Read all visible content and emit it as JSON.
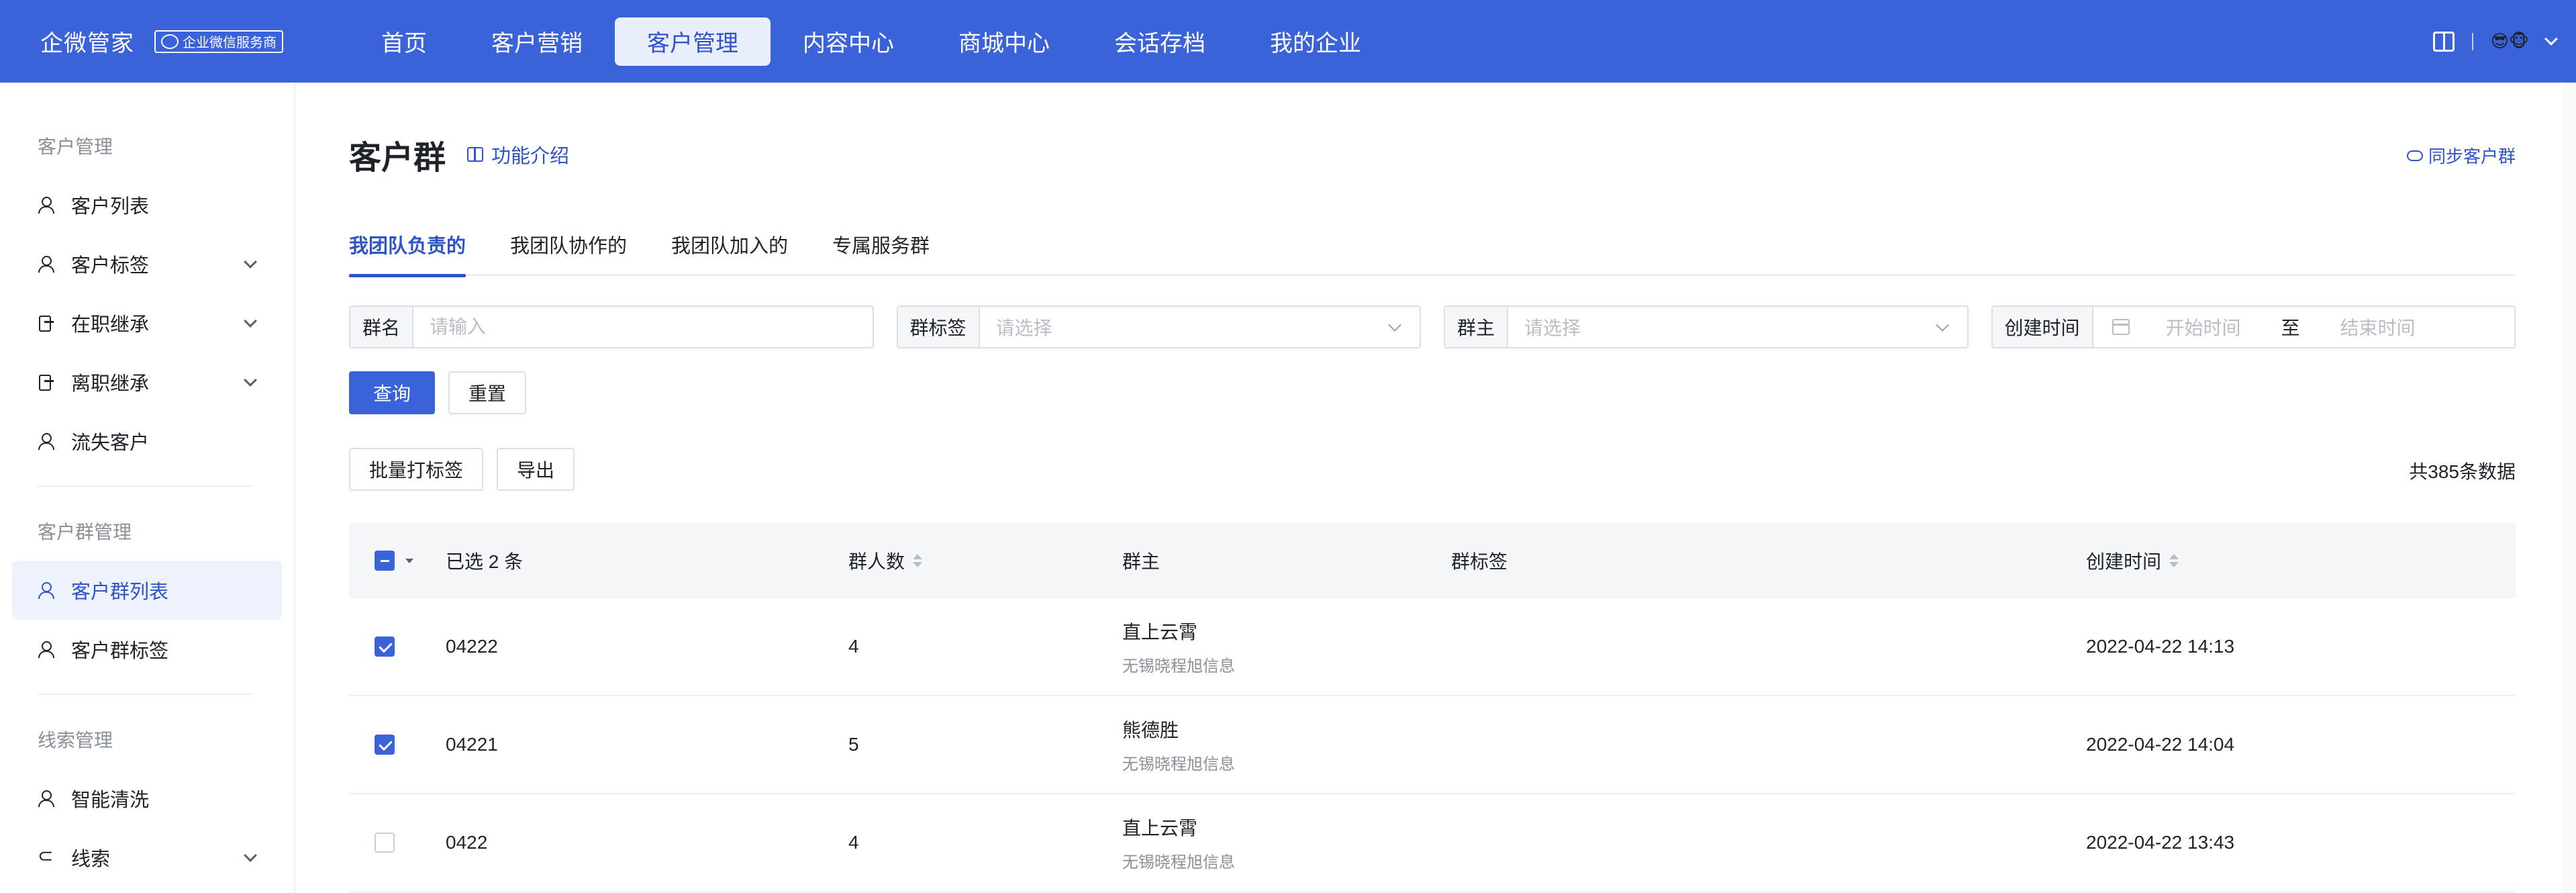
{
  "topbar": {
    "brand": "企微管家",
    "badge": "企业微信服务商",
    "nav": [
      "首页",
      "客户营销",
      "客户管理",
      "内容中心",
      "商城中心",
      "会话存档",
      "我的企业"
    ],
    "active_nav": 2,
    "avatar_emoji": "😎🐵",
    "accent": "#3a62d9"
  },
  "sidebar": {
    "group1": "客户管理",
    "items1": [
      {
        "label": "客户列表",
        "icon": "user-icon"
      },
      {
        "label": "客户标签",
        "icon": "user-icon"
      },
      {
        "label": "在职继承",
        "icon": "door-icon"
      },
      {
        "label": "离职继承",
        "icon": "door-icon"
      },
      {
        "label": "流失客户",
        "icon": "user-icon"
      }
    ],
    "group2": "客户群管理",
    "items2": [
      {
        "label": "客户群列表",
        "icon": "user-icon"
      },
      {
        "label": "客户群标签",
        "icon": "user-icon"
      }
    ],
    "group3": "线索管理",
    "items3": [
      {
        "label": "智能清洗",
        "icon": "user-icon"
      },
      {
        "label": "线索",
        "icon": "link-icon"
      }
    ]
  },
  "page": {
    "title": "客户群",
    "func_intro": "功能介绍",
    "sync": "同步客户群",
    "tabs": [
      "我团队负责的",
      "我团队协作的",
      "我团队加入的",
      "专属服务群"
    ],
    "active_tab": 0
  },
  "filters": {
    "group_name_label": "群名",
    "group_name_placeholder": "请输入",
    "group_tag_label": "群标签",
    "group_tag_placeholder": "请选择",
    "owner_label": "群主",
    "owner_placeholder": "请选择",
    "created_label": "创建时间",
    "start_placeholder": "开始时间",
    "range_sep": "至",
    "end_placeholder": "结束时间"
  },
  "actions": {
    "query": "查询",
    "reset": "重置",
    "batch_tag": "批量打标签",
    "export": "导出",
    "total": "共385条数据"
  },
  "table": {
    "selected": "已选 2 条",
    "columns": {
      "members": "群人数",
      "owner": "群主",
      "tags": "群标签",
      "created": "创建时间"
    },
    "rows": [
      {
        "checked": true,
        "name": "04222",
        "members": "4",
        "owner": "直上云霄",
        "owner_org": "无锡晓程旭信息",
        "tags": "",
        "created": "2022-04-22 14:13"
      },
      {
        "checked": true,
        "name": "04221",
        "members": "5",
        "owner": "熊德胜",
        "owner_org": "无锡晓程旭信息",
        "tags": "",
        "created": "2022-04-22 14:04"
      },
      {
        "checked": false,
        "name": "0422",
        "members": "4",
        "owner": "直上云霄",
        "owner_org": "无锡晓程旭信息",
        "tags": "",
        "created": "2022-04-22 13:43"
      }
    ]
  }
}
